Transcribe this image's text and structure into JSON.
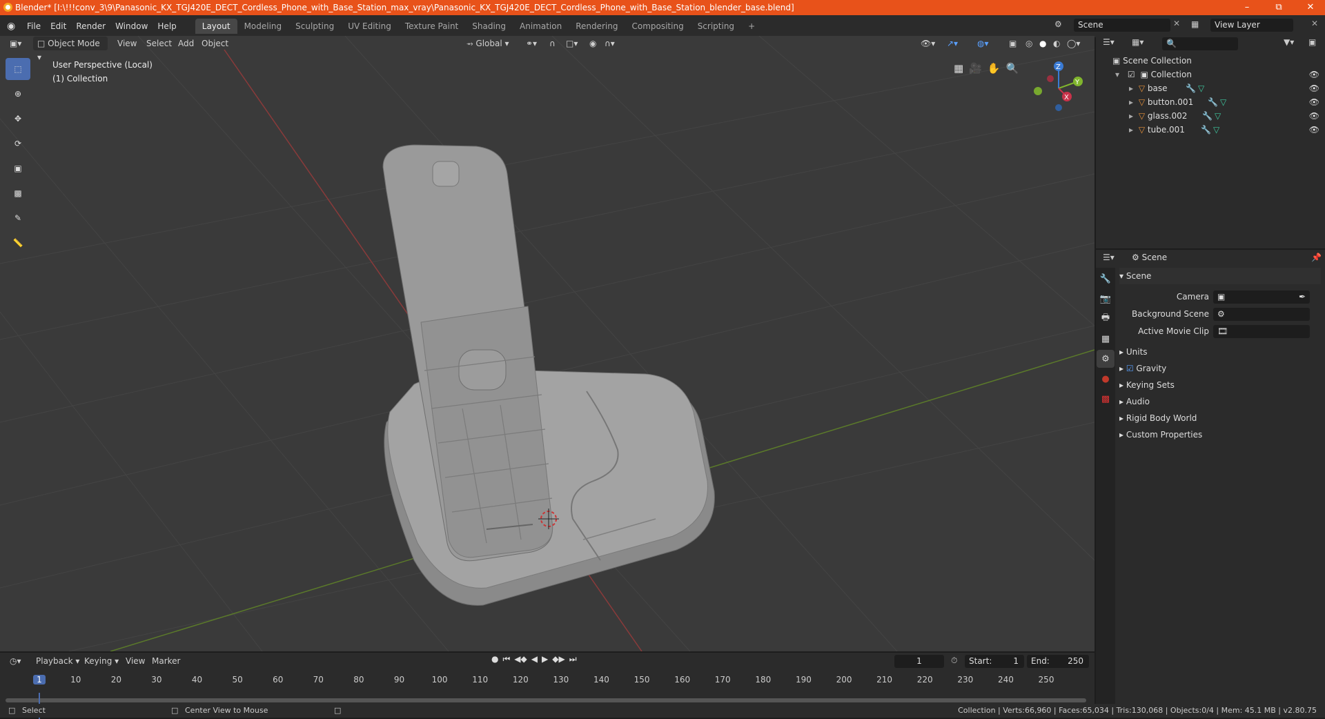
{
  "window": {
    "title": "Blender* [I:\\!!!conv_3\\9\\Panasonic_KX_TGJ420E_DECT_Cordless_Phone_with_Base_Station_max_vray\\Panasonic_KX_TGJ420E_DECT_Cordless_Phone_with_Base_Station_blender_base.blend]",
    "minimize": "–",
    "restore": "⧉",
    "close": "✕"
  },
  "menus": [
    "File",
    "Edit",
    "Render",
    "Window",
    "Help"
  ],
  "workspaces": [
    "Layout",
    "Modeling",
    "Sculpting",
    "UV Editing",
    "Texture Paint",
    "Shading",
    "Animation",
    "Rendering",
    "Compositing",
    "Scripting",
    "+"
  ],
  "scene": {
    "name": "Scene",
    "view_layer": "View Layer"
  },
  "viewport": {
    "mode": "Object Mode",
    "view": "View",
    "select": "Select",
    "add": "Add",
    "object": "Object",
    "orientation": "Global",
    "overlay_line1": "User Perspective (Local)",
    "overlay_line2": "(1) Collection",
    "axis_x": "X",
    "axis_y": "Y",
    "axis_z": "Z"
  },
  "outliner": {
    "root": "Scene Collection",
    "collection": "Collection",
    "items": [
      "base",
      "button.001",
      "glass.002",
      "tube.001"
    ]
  },
  "properties": {
    "header": "Scene",
    "section": "Scene",
    "camera_label": "Camera",
    "bg_scene_label": "Background Scene",
    "movie_clip_label": "Active Movie Clip",
    "panels": [
      "Units",
      "Gravity",
      "Keying Sets",
      "Audio",
      "Rigid Body World",
      "Custom Properties"
    ]
  },
  "timeline": {
    "playback": "Playback",
    "keying": "Keying",
    "view": "View",
    "marker": "Marker",
    "current_frame": "1",
    "start_label": "Start:",
    "start": "1",
    "end_label": "End:",
    "end": "250",
    "ticks": [
      "1",
      "10",
      "20",
      "30",
      "40",
      "50",
      "60",
      "70",
      "80",
      "90",
      "100",
      "110",
      "120",
      "130",
      "140",
      "150",
      "160",
      "170",
      "180",
      "190",
      "200",
      "210",
      "220",
      "230",
      "240",
      "250"
    ]
  },
  "status": {
    "left1": "Select",
    "left2": "Center View to Mouse",
    "right": "Collection | Verts:66,960 | Faces:65,034 | Tris:130,068 | Objects:0/4 | Mem: 45.1 MB | v2.80.75"
  },
  "colors": {
    "title_bar": "#e8521a",
    "active_tool": "#4b6db0",
    "x_axis": "#c9324a",
    "y_axis": "#80b52d",
    "z_axis": "#3a7bd5"
  }
}
